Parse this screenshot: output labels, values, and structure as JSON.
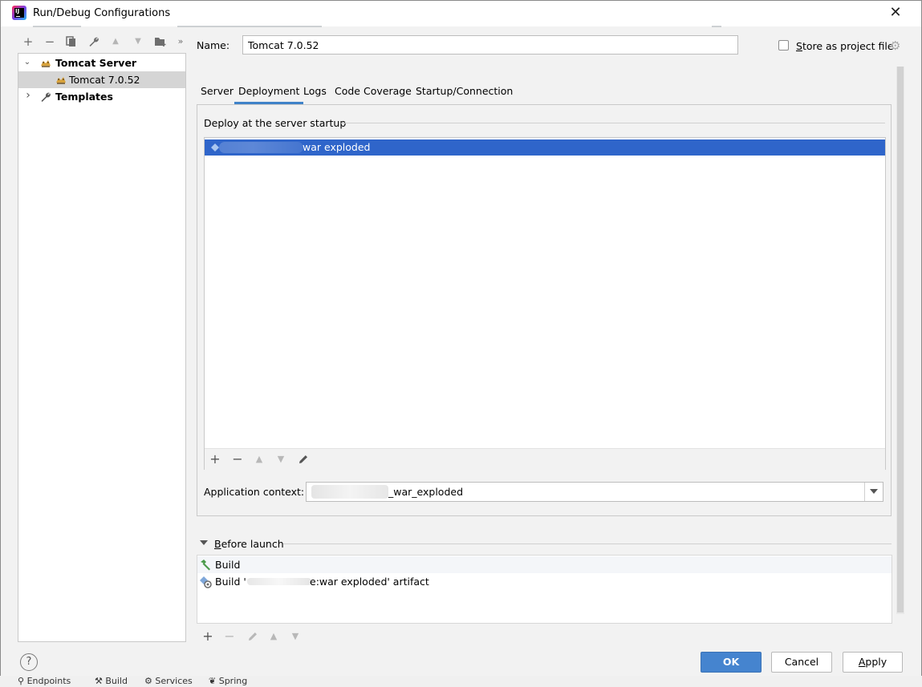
{
  "window": {
    "title": "Run/Debug Configurations",
    "close_glyph": "✕"
  },
  "toolbar": {
    "add": "+",
    "remove": "−",
    "copy": "⧉",
    "edit": "🔧",
    "up": "▲",
    "down": "▼",
    "folder": "📁",
    "more": "»"
  },
  "tree": {
    "items": [
      {
        "label": "Tomcat Server",
        "arrow": "⌄",
        "icon": "tomcat-icon"
      },
      {
        "label": "Tomcat 7.0.52",
        "icon": "tomcat-icon"
      },
      {
        "label": "Templates",
        "arrow": "›",
        "icon": "wrench-icon"
      }
    ]
  },
  "name": {
    "label": "Name:",
    "value": "Tomcat 7.0.52"
  },
  "store": {
    "label_first": "S",
    "label_rest": "tore as project file",
    "checked": false
  },
  "tabs": [
    {
      "label": "Server",
      "active": false
    },
    {
      "label": "Deployment",
      "active": true
    },
    {
      "label": "Logs",
      "active": false
    },
    {
      "label": "Code Coverage",
      "active": false
    },
    {
      "label": "Startup/Connection",
      "active": false
    }
  ],
  "deployment": {
    "heading": "Deploy at the server startup",
    "items": [
      {
        "text": "war exploded",
        "selected": true
      }
    ],
    "toolbar": {
      "add": "+",
      "remove": "−",
      "up": "▲",
      "down": "▼",
      "edit": "✎"
    }
  },
  "app_context": {
    "label": "Application context:",
    "value": "_war_exploded"
  },
  "before_launch": {
    "label_first": "B",
    "label_rest": "efore launch",
    "items": [
      {
        "prefix": "Build",
        "text": "",
        "icon": "hammer-icon"
      },
      {
        "prefix": "Build '",
        "text": "e:war exploded' artifact",
        "icon": "artifact-icon"
      }
    ],
    "toolbar": {
      "add": "+",
      "remove": "−",
      "edit": "✎",
      "up": "▲",
      "down": "▼"
    }
  },
  "buttons": {
    "help": "?",
    "ok": "OK",
    "cancel": "Cancel",
    "apply_first": "A",
    "apply_rest": "pply"
  },
  "underbar": {
    "items": [
      "Endpoints",
      "Build",
      "Services",
      "Spring"
    ]
  },
  "colors": {
    "selection": "#2f65ca",
    "ok_button": "#4584cf",
    "tab_underline": "#4083c9"
  }
}
